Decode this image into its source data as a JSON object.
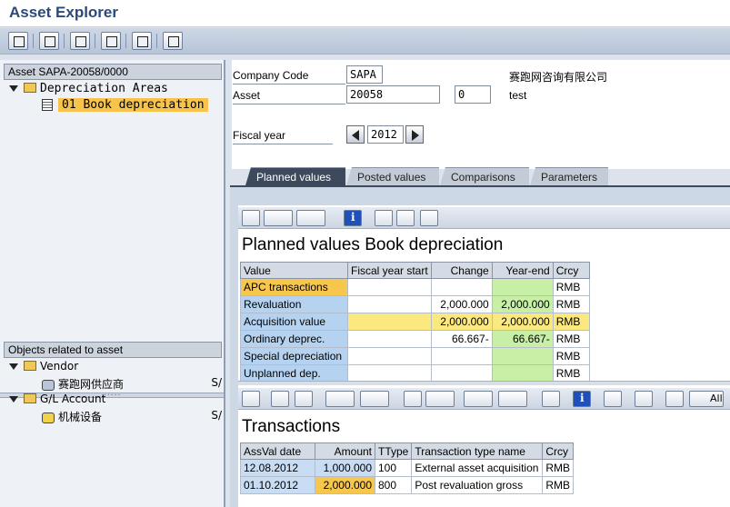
{
  "app": {
    "title": "Asset Explorer"
  },
  "toolbar": {
    "icons": [
      "refresh-icon",
      "save-icon",
      "grid-icon",
      "list-icon",
      "settings-icon",
      "document-icon"
    ]
  },
  "left_tree": {
    "header": "Asset SAPA-20058/0000",
    "folder": "Depreciation Areas",
    "selected_item": "01 Book depreciation"
  },
  "related": {
    "header": "Objects related to asset",
    "vendor_label": "Vendor",
    "vendor_item": "赛跑网供应商",
    "vendor_suffix": "S/",
    "gl_label": "G/L Account",
    "gl_item": "机械设备",
    "gl_suffix": "S/"
  },
  "header": {
    "company_code_label": "Company Code",
    "company_code_value": "SAPA",
    "company_name": "赛跑网咨询有限公司",
    "asset_label": "Asset",
    "asset_value": "20058",
    "asset_sub": "0",
    "asset_desc": "test",
    "fiscal_year_label": "Fiscal year",
    "fiscal_year_value": "2012"
  },
  "tabs": [
    {
      "label": "Planned values",
      "active": true
    },
    {
      "label": "Posted values",
      "active": false
    },
    {
      "label": "Comparisons",
      "active": false
    },
    {
      "label": "Parameters",
      "active": false
    }
  ],
  "planned": {
    "title": "Planned values Book depreciation",
    "columns": [
      "Value",
      "Fiscal year start",
      "Change",
      "Year-end",
      "Crcy"
    ],
    "rows": [
      {
        "value": "APC transactions",
        "fy_start": "",
        "change": "",
        "year_end": "",
        "crcy": "RMB"
      },
      {
        "value": "Revaluation",
        "fy_start": "",
        "change": "2,000.000",
        "year_end": "2,000.000",
        "crcy": "RMB"
      },
      {
        "value": "Acquisition value",
        "fy_start": "",
        "change": "2,000.000",
        "year_end": "2,000.000",
        "crcy": "RMB"
      },
      {
        "value": "Ordinary deprec.",
        "fy_start": "",
        "change": "66.667-",
        "year_end": "66.667-",
        "crcy": "RMB"
      },
      {
        "value": "Special depreciation",
        "fy_start": "",
        "change": "",
        "year_end": "",
        "crcy": "RMB"
      },
      {
        "value": "Unplanned dep.",
        "fy_start": "",
        "change": "",
        "year_end": "",
        "crcy": "RMB"
      }
    ]
  },
  "transactions": {
    "title": "Transactions",
    "all_label": "All",
    "columns": [
      "AssVal date",
      "Amount",
      "TType",
      "Transaction type name",
      "Crcy"
    ],
    "rows": [
      {
        "date": "12.08.2012",
        "amount": "1,000.000",
        "ttype": "100",
        "name": "External asset acquisition",
        "crcy": "RMB"
      },
      {
        "date": "01.10.2012",
        "amount": "2,000.000",
        "ttype": "800",
        "name": "Post revaluation gross",
        "crcy": "RMB"
      }
    ]
  }
}
